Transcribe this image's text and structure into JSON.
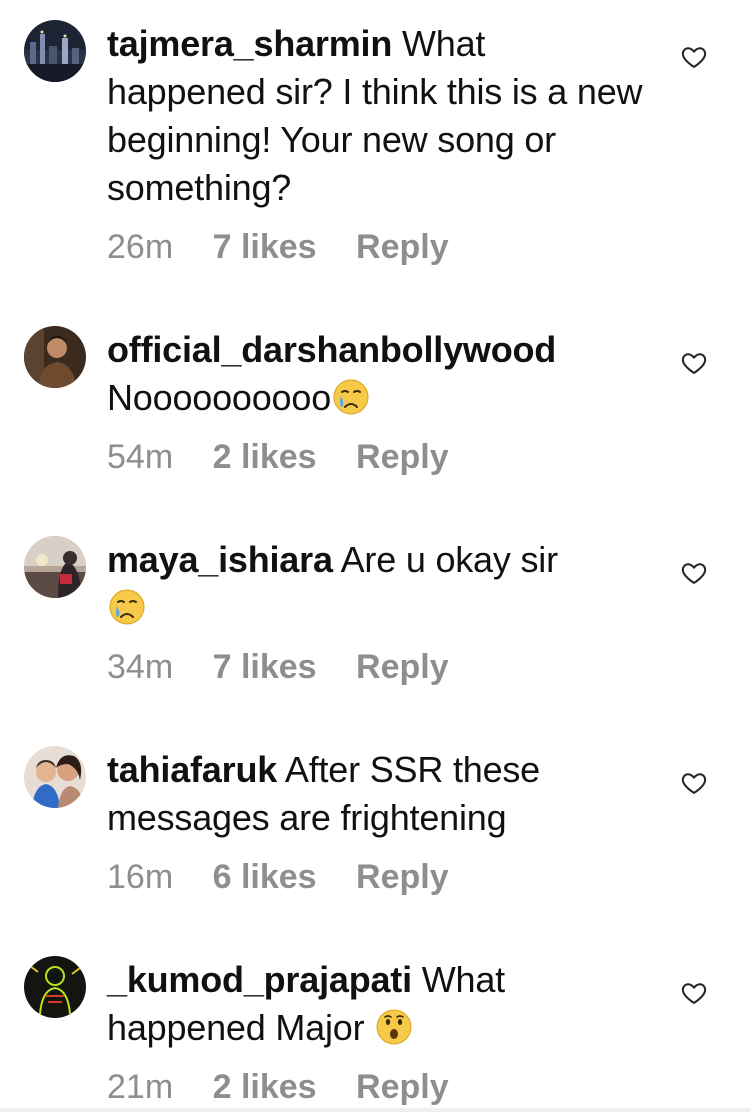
{
  "comments": [
    {
      "username": "tajmera_sharmin",
      "text": "What happened sir? I think this is a new beginning! Your new song or something?",
      "time": "26m",
      "likes": "7 likes",
      "reply": "Reply",
      "avatar_icon": "city-night-avatar"
    },
    {
      "username": "official_darshanbollywood",
      "text": "Noooooooooo",
      "emoji": "crying-face",
      "time": "54m",
      "likes": "2 likes",
      "reply": "Reply",
      "avatar_icon": "man-portrait-avatar"
    },
    {
      "username": "maya_ishiara",
      "text": "Are u okay sir",
      "emoji": "crying-face",
      "time": "34m",
      "likes": "7 likes",
      "reply": "Reply",
      "avatar_icon": "sunset-person-avatar"
    },
    {
      "username": "tahiafaruk",
      "text": "After SSR these messages are frightening",
      "time": "16m",
      "likes": "6 likes",
      "reply": "Reply",
      "avatar_icon": "mother-child-avatar"
    },
    {
      "username": "_kumod_prajapati",
      "text": "What happened Major",
      "emoji": "surprised-face",
      "time": "21m",
      "likes": "2 likes",
      "reply": "Reply",
      "avatar_icon": "neon-figure-avatar"
    }
  ],
  "colors": {
    "text": "#111111",
    "meta": "#8e8e8e",
    "heart_stroke": "#262626",
    "emoji_yellow": "#f7c948",
    "tear_blue": "#5aa7e6"
  }
}
